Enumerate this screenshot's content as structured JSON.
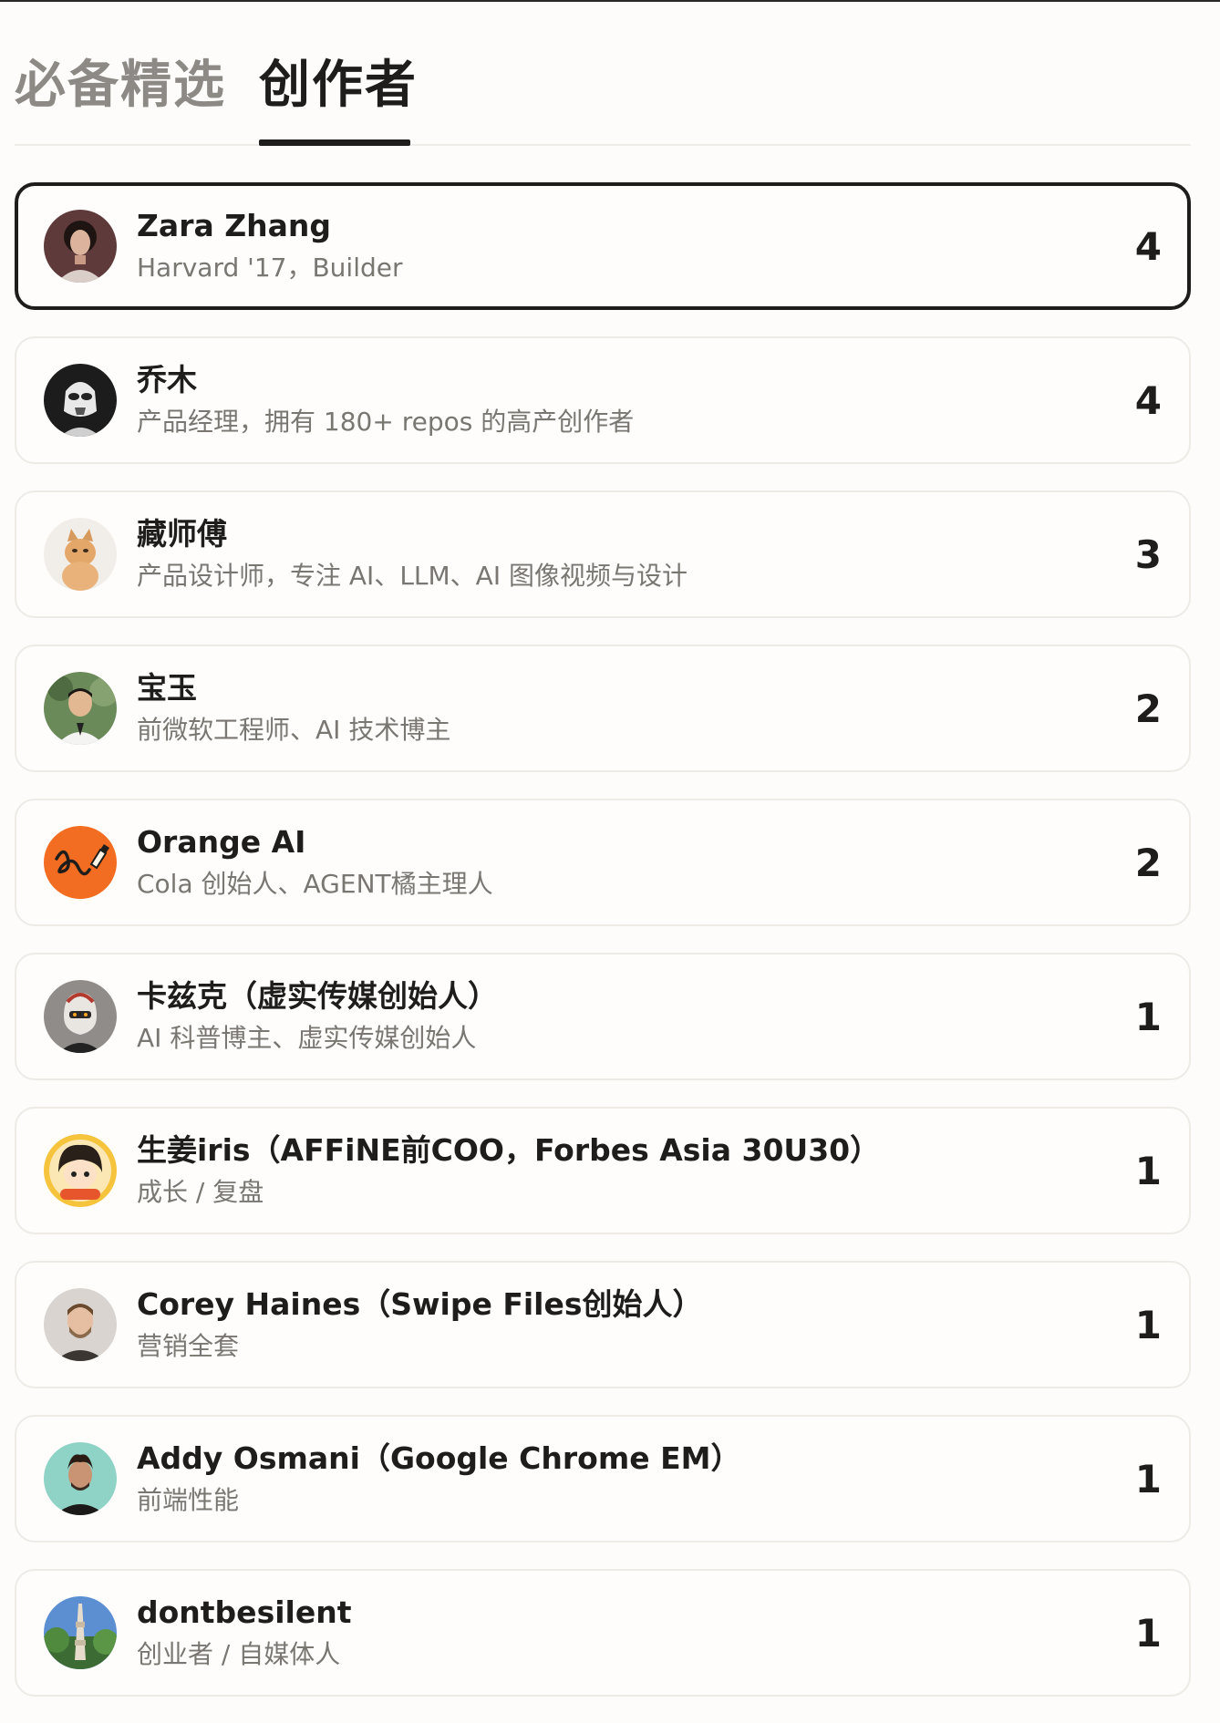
{
  "tabs": [
    {
      "label": "必备精选",
      "active": false
    },
    {
      "label": "创作者",
      "active": true
    }
  ],
  "creators": [
    {
      "name": "Zara Zhang",
      "desc": "Harvard '17，Builder",
      "count": "4",
      "avatar": "portrait-avatar-woman"
    },
    {
      "name": "乔木",
      "desc": "产品经理，拥有 180+ repos 的高产创作者",
      "count": "4",
      "avatar": "stormtrooper-avatar"
    },
    {
      "name": "藏师傅",
      "desc": "产品设计师，专注 AI、LLM、AI 图像视频与设计",
      "count": "3",
      "avatar": "cat-avatar"
    },
    {
      "name": "宝玉",
      "desc": "前微软工程师、AI 技术博主",
      "count": "2",
      "avatar": "portrait-avatar-man"
    },
    {
      "name": "Orange AI",
      "desc": "Cola 创始人、AGENT橘主理人",
      "count": "2",
      "avatar": "orange-squiggle-avatar"
    },
    {
      "name": "卡兹克（虚实传媒创始人）",
      "desc": "AI 科普博主、虚实传媒创始人",
      "count": "1",
      "avatar": "robot-avatar"
    },
    {
      "name": "生姜iris（AFFiNE前COO，Forbes Asia 30U30）",
      "desc": "成长 / 复盘",
      "count": "1",
      "avatar": "cartoon-girl-avatar"
    },
    {
      "name": "Corey Haines（Swipe Files创始人）",
      "desc": "营销全套",
      "count": "1",
      "avatar": "portrait-avatar-man"
    },
    {
      "name": "Addy Osmani（Google Chrome EM）",
      "desc": "前端性能",
      "count": "1",
      "avatar": "portrait-avatar-man"
    },
    {
      "name": "dontbesilent",
      "desc": "创业者 / 自媒体人",
      "count": "1",
      "avatar": "tower-avatar"
    }
  ],
  "colors": {
    "background": "#fdfcfa",
    "text": "#1f1d1b",
    "muted": "#7a7672",
    "inactive_tab": "#8d8a86",
    "card_border": "#eeebe7",
    "selected_border": "#1f1d1b",
    "orange_avatar": "#f26d21"
  }
}
